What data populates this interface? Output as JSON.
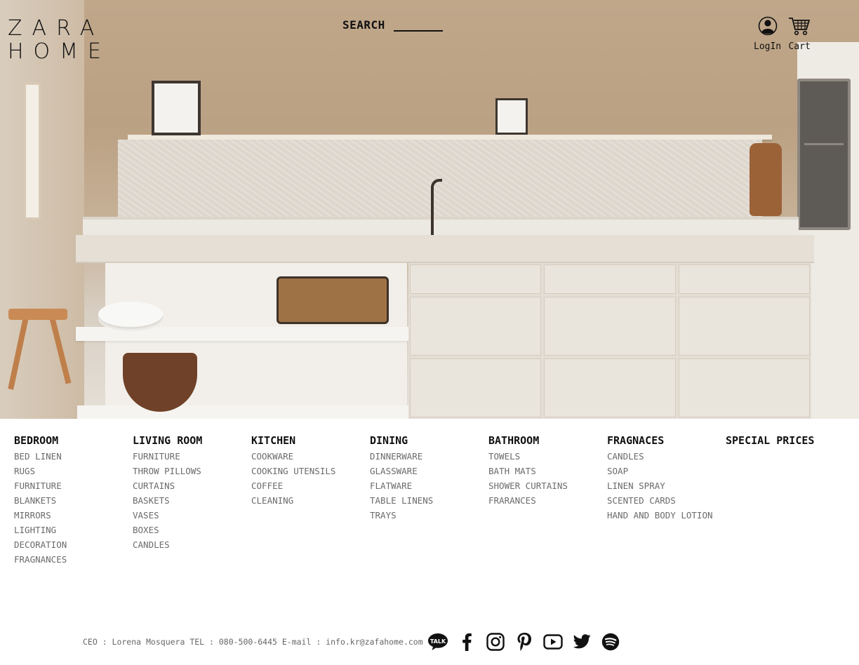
{
  "brand": {
    "logo_line1": "ZARA",
    "logo_line2": "HOME"
  },
  "search": {
    "label": "SEARCH",
    "value": "",
    "placeholder": ""
  },
  "header": {
    "login_label": "LogIn",
    "cart_label": "Cart"
  },
  "menu": [
    {
      "title": "BEDROOM",
      "items": [
        "BED LINEN",
        "RUGS",
        "FURNITURE",
        "BLANKETS",
        "MIRRORS",
        "LIGHTING",
        "DECORATION",
        "FRAGNANCES"
      ]
    },
    {
      "title": "LIVING ROOM",
      "items": [
        "FURNITURE",
        "THROW PILLOWS",
        "CURTAINS",
        "BASKETS",
        "VASES",
        "BOXES",
        "CANDLES"
      ]
    },
    {
      "title": "KITCHEN",
      "items": [
        "COOKWARE",
        "COOKING UTENSILS",
        "COFFEE",
        "CLEANING"
      ]
    },
    {
      "title": "DINING",
      "items": [
        "DINNERWARE",
        "GLASSWARE",
        "FLATWARE",
        "TABLE LINENS",
        "TRAYS"
      ]
    },
    {
      "title": "BATHROOM",
      "items": [
        "TOWELS",
        "BATH MATS",
        "SHOWER CURTAINS",
        "FRARANCES"
      ]
    },
    {
      "title": "FRAGNACES",
      "items": [
        "CANDLES",
        "SOAP",
        "LINEN SPRAY",
        "SCENTED CARDS",
        "HAND AND BODY LOTION"
      ]
    },
    {
      "title": "SPECIAL PRICES",
      "items": []
    }
  ],
  "footer": {
    "info": "CEO : Lorena Mosquera TEL : 080-500-6445 E-mail : info.kr@zafahome.com",
    "kakao_icon_text": "TALK",
    "social_icons": [
      "kakaotalk-icon",
      "facebook-icon",
      "instagram-icon",
      "pinterest-icon",
      "youtube-icon",
      "twitter-icon",
      "spotify-icon"
    ]
  },
  "colors": {
    "text": "#111111",
    "muted": "#6b6b6b",
    "background": "#ffffff"
  }
}
